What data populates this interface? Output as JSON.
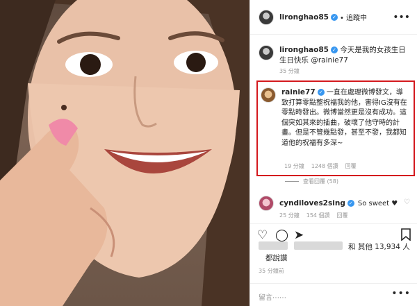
{
  "post": {
    "author": "lironghao85",
    "follow_label": "• 追蹤中"
  },
  "caption": {
    "user": "lironghao85",
    "text": "今天是我的女孩生日生日快乐 @rainie77",
    "time": "35 分鐘"
  },
  "highlighted_comment": {
    "user": "rainie77",
    "text": "一直在處理微博發文，導致打算零點整祝福我的他，害得IG沒有在零點時發出。微博當然更是沒有成功。這個突如其來的插曲，破壞了他守時的計畫。但是不管幾點發，甚至不發，我都知道他的祝福有多深~",
    "time": "19 分鐘",
    "likes": "1248 個讚",
    "reply_label": "回覆",
    "view_replies": "查看回覆 (58)"
  },
  "second_comment": {
    "user": "cyndiloves2sing",
    "text": "So sweet ♥",
    "time": "25 分鐘",
    "likes": "154 個讚",
    "reply_label": "回覆"
  },
  "likes_summary": {
    "text": "和 其他 13,934 人",
    "line2": "都說讚",
    "time": "35 分鐘前"
  },
  "add_comment": {
    "placeholder": "留言⋯⋯",
    "more": "•••"
  },
  "icons": {
    "header_more": "more-dots-icon",
    "like": "heart-icon",
    "comment": "comment-icon",
    "share": "share-icon",
    "save": "bookmark-icon"
  }
}
